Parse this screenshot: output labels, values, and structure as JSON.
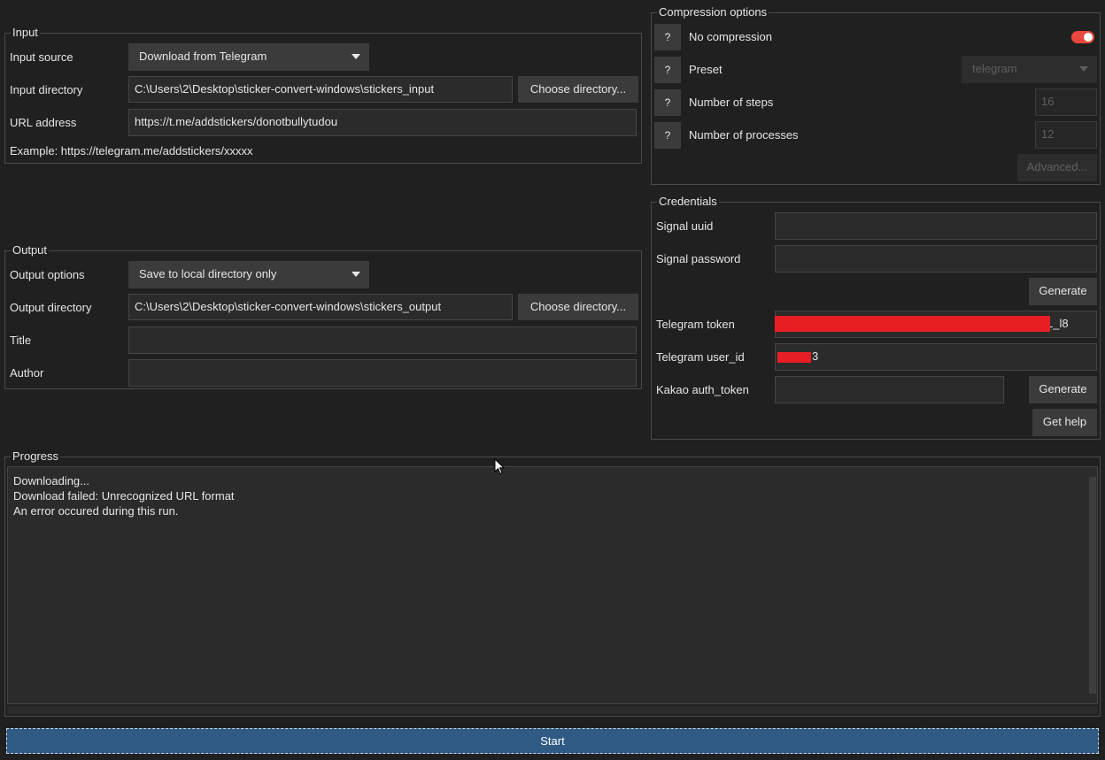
{
  "input": {
    "legend": "Input",
    "source_label": "Input source",
    "source_value": "Download from Telegram",
    "dir_label": "Input directory",
    "dir_value": "C:\\Users\\2\\Desktop\\sticker-convert-windows\\stickers_input",
    "choose_label": "Choose directory...",
    "url_label": "URL address",
    "url_value": "https://t.me/addstickers/donotbullytudou",
    "example": "Example: https://telegram.me/addstickers/xxxxx"
  },
  "output": {
    "legend": "Output",
    "options_label": "Output options",
    "options_value": "Save to local directory only",
    "dir_label": "Output directory",
    "dir_value": "C:\\Users\\2\\Desktop\\sticker-convert-windows\\stickers_output",
    "choose_label": "Choose directory...",
    "title_label": "Title",
    "title_value": "",
    "author_label": "Author",
    "author_value": ""
  },
  "compression": {
    "legend": "Compression options",
    "help_label": "?",
    "no_compression_label": "No compression",
    "no_compression_on": true,
    "preset_label": "Preset",
    "preset_value": "telegram",
    "steps_label": "Number of steps",
    "steps_value": "16",
    "processes_label": "Number of processes",
    "processes_value": "12",
    "advanced_label": "Advanced..."
  },
  "credentials": {
    "legend": "Credentials",
    "signal_uuid_label": "Signal uuid",
    "signal_uuid_value": "",
    "signal_password_label": "Signal password",
    "signal_password_value": "",
    "generate_label": "Generate",
    "telegram_token_label": "Telegram token",
    "telegram_token_visible": "L_l8",
    "telegram_userid_label": "Telegram user_id",
    "telegram_userid_visible": "3",
    "kakao_label": "Kakao auth_token",
    "kakao_value": "",
    "kakao_generate_label": "Generate",
    "get_help_label": "Get help"
  },
  "progress": {
    "legend": "Progress",
    "log_lines": [
      "Downloading...",
      "Download failed: Unrecognized URL format",
      "An error occured during this run."
    ]
  },
  "start_label": "Start",
  "colors": {
    "background": "#202020",
    "button": "#3b3b3b",
    "toggle_on": "#e9473d",
    "start_button": "#2f5a84",
    "redaction": "#e81e25"
  }
}
